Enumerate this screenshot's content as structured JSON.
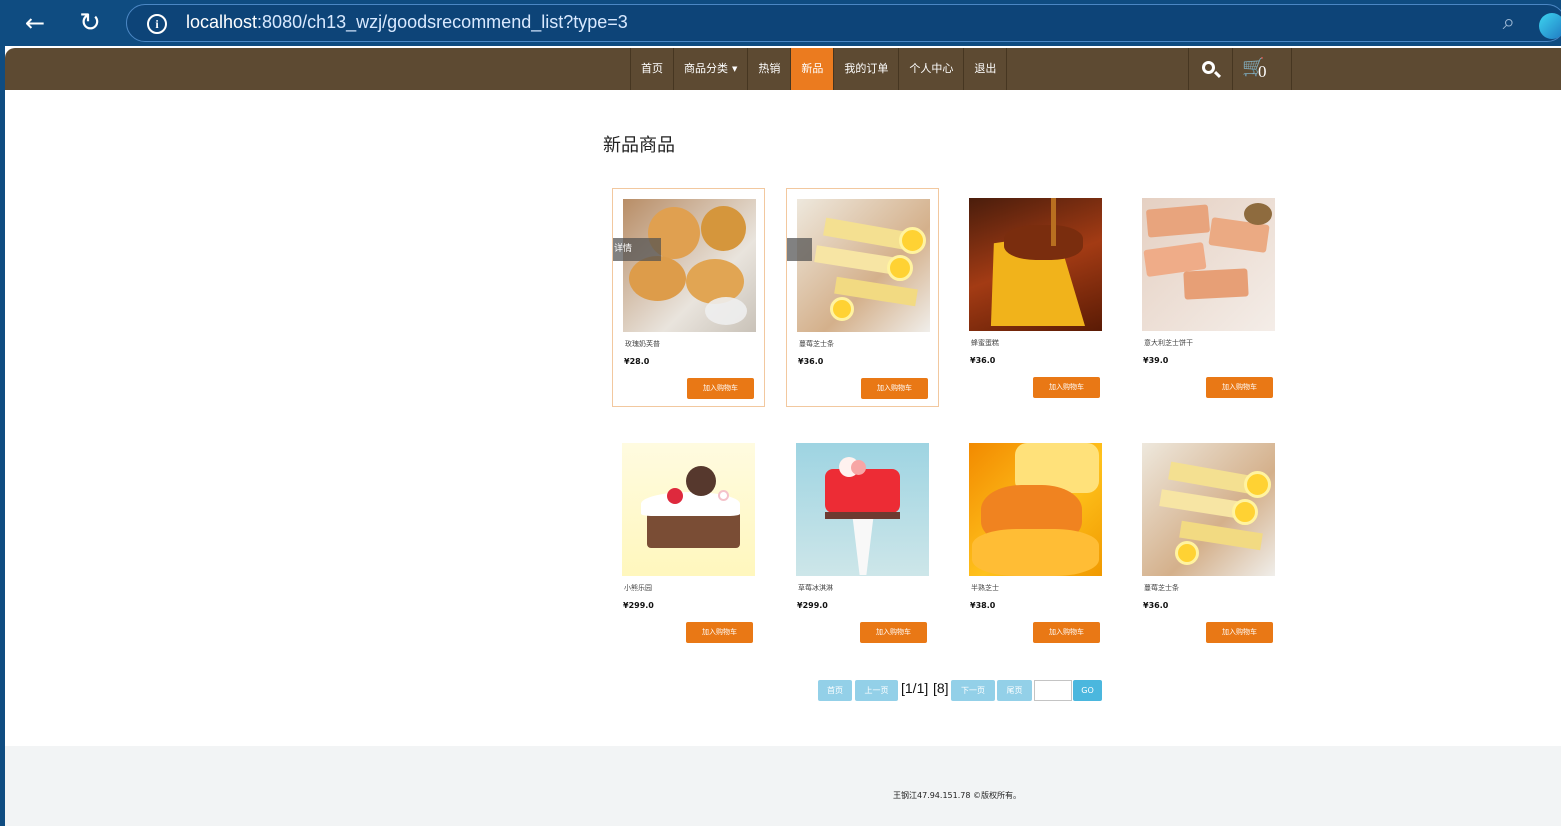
{
  "browser": {
    "url_host": "localhost",
    "url_path": ":8080/ch13_wzj/goodsrecommend_list?type=3"
  },
  "nav": {
    "items": [
      {
        "label": "首页"
      },
      {
        "label": "商品分类"
      },
      {
        "label": "热销"
      },
      {
        "label": "新品",
        "active": true
      },
      {
        "label": "我的订单"
      },
      {
        "label": "个人中心"
      },
      {
        "label": "退出"
      }
    ],
    "cart_count": "0",
    "search_icon": "search-icon",
    "cart_icon": "cart-icon"
  },
  "page": {
    "title": "新品商品"
  },
  "products": [
    {
      "name": "玫瑰奶芙普",
      "price": "¥28.0",
      "button": "加入购物车",
      "overlay": "详情",
      "highlighted": true
    },
    {
      "name": "蔓莓芝士条",
      "price": "¥36.0",
      "button": "加入购物车",
      "overlay": "",
      "highlighted": true
    },
    {
      "name": "蜂蜜蛋糕",
      "price": "¥36.0",
      "button": "加入购物车",
      "overlay": "",
      "highlighted": false
    },
    {
      "name": "意大利芝士饼干",
      "price": "¥39.0",
      "button": "加入购物车",
      "overlay": "",
      "highlighted": false
    },
    {
      "name": "小熊乐园",
      "price": "¥299.0",
      "button": "加入购物车",
      "overlay": "",
      "highlighted": false
    },
    {
      "name": "草莓冰淇淋",
      "price": "¥299.0",
      "button": "加入购物车",
      "overlay": "",
      "highlighted": false
    },
    {
      "name": "半熟芝士",
      "price": "¥38.0",
      "button": "加入购物车",
      "overlay": "",
      "highlighted": false
    },
    {
      "name": "蔓莓芝士条",
      "price": "¥36.0",
      "button": "加入购物车",
      "overlay": "",
      "highlighted": false
    }
  ],
  "pagination": {
    "first": "首页",
    "previous": "上一页",
    "page_info": "[1/1]",
    "total": "[8]",
    "next": "下一页",
    "last": "尾页",
    "go": "GO",
    "page_input": ""
  },
  "footer": {
    "text": "王钢江47.94.151.78 ©版权所有。"
  },
  "colors": {
    "nav_bg": "#5d4a32",
    "accent": "#eb7b1f",
    "pager": "#93d0e8"
  }
}
